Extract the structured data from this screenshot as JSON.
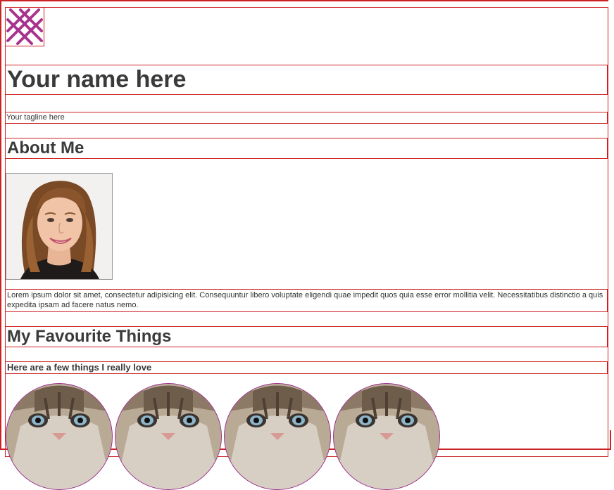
{
  "brand": {
    "logo_icon": "crosshatch-logo-icon",
    "accent_color": "#a8338f"
  },
  "header": {
    "name": "Your name here",
    "tagline": "Your tagline here"
  },
  "about": {
    "title": "About Me",
    "photo_alt": "profile-photo",
    "text": "Lorem ipsum dolor sit amet, consectetur adipisicing elit. Consequuntur libero voluptate eligendi quae impedit quos quia esse error mollitia velit. Necessitatibus distinctio a quis expedita ipsam ad facere natus nemo."
  },
  "favourites": {
    "title": "My Favourite Things",
    "subtitle": "Here are a few things I really love",
    "items": [
      {
        "image": "kitten-image"
      },
      {
        "image": "kitten-image"
      },
      {
        "image": "kitten-image"
      },
      {
        "image": "kitten-image"
      }
    ]
  },
  "colors": {
    "outline": "#cc2222",
    "text": "#3a3a3a",
    "circle_border": "#9b2d8e"
  }
}
